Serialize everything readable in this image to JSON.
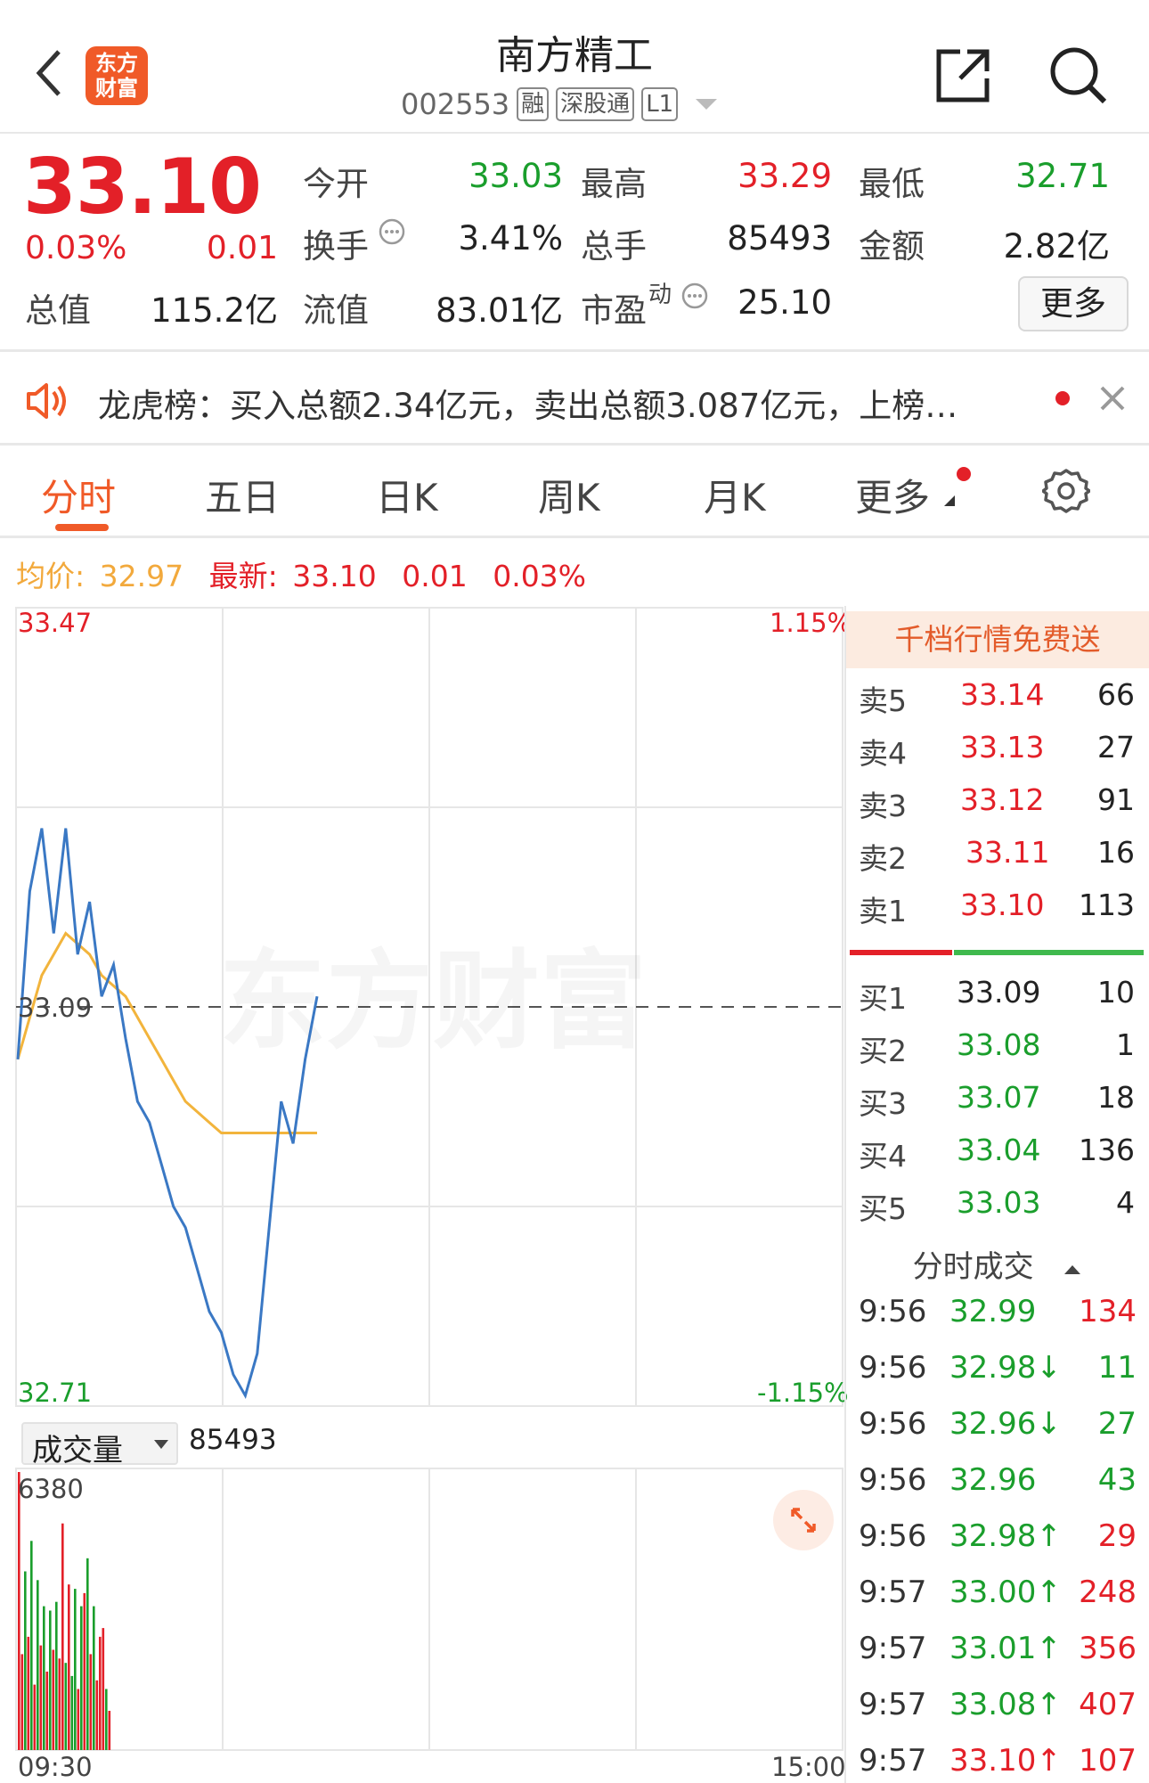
{
  "header": {
    "title": "南方精工",
    "code": "002553",
    "tags": [
      "融",
      "深股通",
      "L1"
    ],
    "logo_text": [
      "东方",
      "财富"
    ]
  },
  "quote": {
    "price": "33.10",
    "change_pct": "0.03%",
    "change": "0.01",
    "open_label": "今开",
    "open": "33.03",
    "high_label": "最高",
    "high": "33.29",
    "low_label": "最低",
    "low": "32.71",
    "turnover_label": "换手",
    "turnover": "3.41%",
    "volume_label": "总手",
    "volume": "85493",
    "amount_label": "金额",
    "amount": "2.82亿",
    "mktcap_label": "总值",
    "mktcap": "115.2亿",
    "float_label": "流值",
    "float_cap": "83.01亿",
    "pe_label": "市盈",
    "pe_sup": "动",
    "pe": "25.10",
    "more_label": "更多"
  },
  "notice": {
    "text": "龙虎榜：买入总额2.34亿元，卖出总额3.087亿元，上榜…"
  },
  "tabs": [
    "分时",
    "五日",
    "日K",
    "周K",
    "月K",
    "更多"
  ],
  "infobar": {
    "avg_label": "均价:",
    "avg": "32.97",
    "latest_label": "最新:",
    "latest": "33.10",
    "chg": "0.01",
    "pct": "0.03%"
  },
  "chart": {
    "y_top": "33.47",
    "y_bottom": "32.71",
    "y_mid": "33.09",
    "pct_top": "1.15%",
    "pct_bottom": "-1.15%",
    "watermark": "东方财富",
    "volume_selector": "成交量",
    "volume_total": "85493",
    "volume_max": "6380",
    "x_start": "09:30",
    "x_end": "15:00"
  },
  "chart_data": {
    "type": "line",
    "title": "",
    "xlabel": "",
    "ylabel": "",
    "ylim": [
      32.71,
      33.47
    ],
    "x_range": [
      "09:30",
      "15:00"
    ],
    "series": [
      {
        "values": [
          33.04,
          33.2,
          33.26,
          33.16,
          33.26,
          33.14,
          33.19,
          33.1,
          33.13,
          33.06,
          33.0,
          32.98,
          32.94,
          32.9,
          32.88,
          32.84,
          32.8,
          32.78,
          32.74,
          32.72,
          32.76,
          32.88,
          33.0,
          32.96,
          33.04,
          33.1
        ]
      },
      {
        "values": [
          33.04,
          33.08,
          33.12,
          33.14,
          33.16,
          33.15,
          33.14,
          33.12,
          33.11,
          33.1,
          33.08,
          33.06,
          33.04,
          33.02,
          33.0,
          32.99,
          32.98,
          32.97,
          32.97,
          32.97,
          32.97,
          32.97,
          32.97,
          32.97,
          32.97,
          32.97
        ]
      }
    ],
    "volume": {
      "ylim": [
        0,
        6380
      ],
      "values": [
        6380,
        2200,
        4100,
        2600,
        4800,
        1500,
        3900,
        2400,
        3300,
        1800,
        3200,
        2300,
        3400,
        2100,
        5200,
        2000,
        3800,
        1700,
        3700,
        1400,
        3300,
        3600,
        4400,
        2200,
        3300,
        1600,
        2600,
        2800,
        1400,
        900
      ],
      "colors": [
        "red",
        "red",
        "green",
        "red",
        "green",
        "red",
        "green",
        "red",
        "green",
        "red",
        "green",
        "red",
        "green",
        "red",
        "red",
        "green",
        "red",
        "green",
        "green",
        "red",
        "green",
        "red",
        "green",
        "red",
        "green",
        "red",
        "red",
        "red",
        "green",
        "red"
      ]
    }
  },
  "orderbook": {
    "banner": "千档行情免费送",
    "sell": [
      {
        "label": "卖5",
        "price": "33.14",
        "vol": "66"
      },
      {
        "label": "卖4",
        "price": "33.13",
        "vol": "27"
      },
      {
        "label": "卖3",
        "price": "33.12",
        "vol": "91"
      },
      {
        "label": "卖2",
        "price": "33.11",
        "vol": "16"
      },
      {
        "label": "卖1",
        "price": "33.10",
        "vol": "113"
      }
    ],
    "buy": [
      {
        "label": "买1",
        "price": "33.09",
        "vol": "10"
      },
      {
        "label": "买2",
        "price": "33.08",
        "vol": "1"
      },
      {
        "label": "买3",
        "price": "33.07",
        "vol": "18"
      },
      {
        "label": "买4",
        "price": "33.04",
        "vol": "136"
      },
      {
        "label": "买5",
        "price": "33.03",
        "vol": "4"
      }
    ]
  },
  "trades": {
    "title": "分时成交",
    "rows": [
      {
        "time": "9:56",
        "price": "32.99",
        "vol": "134"
      },
      {
        "time": "9:56",
        "price": "32.98↓",
        "vol": "11"
      },
      {
        "time": "9:56",
        "price": "32.96↓",
        "vol": "27"
      },
      {
        "time": "9:56",
        "price": "32.96",
        "vol": "43"
      },
      {
        "time": "9:56",
        "price": "32.98↑",
        "vol": "29"
      },
      {
        "time": "9:57",
        "price": "33.00↑",
        "vol": "248"
      },
      {
        "time": "9:57",
        "price": "33.01↑",
        "vol": "356"
      },
      {
        "time": "9:57",
        "price": "33.08↑",
        "vol": "407"
      },
      {
        "time": "9:57",
        "price": "33.10↑",
        "vol": "107"
      }
    ]
  },
  "colors": {
    "up": "#e32028",
    "down": "#1a9e2c",
    "accent": "#f05a28",
    "avg_line": "#f2b43c",
    "price_line": "#3a78c4"
  }
}
